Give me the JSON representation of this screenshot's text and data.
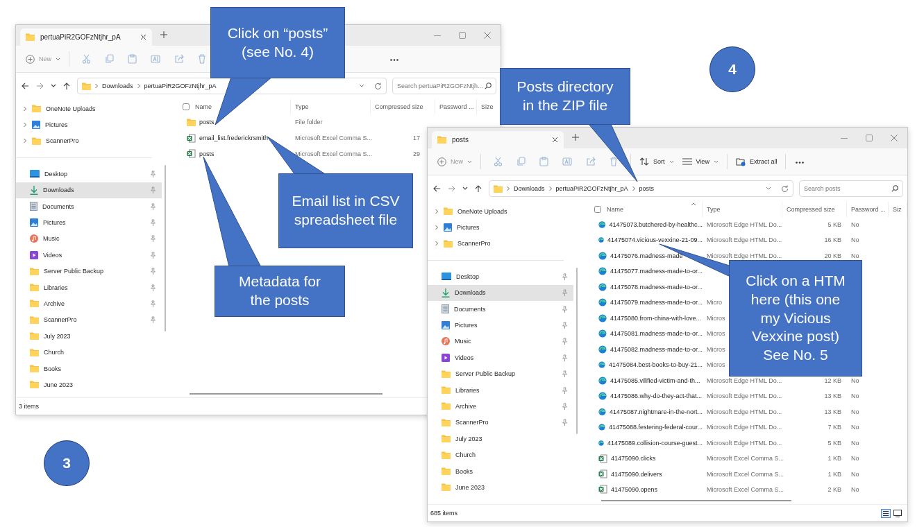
{
  "windows": [
    {
      "tab_title": "pertuaPiR2GOFzNtjhr_pA",
      "toolbar": [
        {
          "kind": "new",
          "label": "New"
        }
      ],
      "breadcrumb": [
        "Downloads",
        "pertuaPiR2GOFzNtjhr_pA"
      ],
      "search_placeholder": "Search pertuaPiR2GOFzNtjh...",
      "nav_tree": [
        {
          "label": "OneNote Uploads",
          "kind": "folder"
        },
        {
          "label": "Pictures",
          "kind": "pictures"
        },
        {
          "label": "ScannerPro",
          "kind": "folder"
        }
      ],
      "quick_access": [
        {
          "label": "Desktop",
          "kind": "desktop",
          "pinned": true,
          "selected": false
        },
        {
          "label": "Downloads",
          "kind": "downloads",
          "pinned": true,
          "selected": true
        },
        {
          "label": "Documents",
          "kind": "documents",
          "pinned": true,
          "selected": false
        },
        {
          "label": "Pictures",
          "kind": "pictures",
          "pinned": true,
          "selected": false
        },
        {
          "label": "Music",
          "kind": "music",
          "pinned": true,
          "selected": false
        },
        {
          "label": "Videos",
          "kind": "videos",
          "pinned": true,
          "selected": false
        },
        {
          "label": "Server Public Backup",
          "kind": "folder",
          "pinned": true,
          "selected": false
        },
        {
          "label": "Libraries",
          "kind": "folder",
          "pinned": true,
          "selected": false
        },
        {
          "label": "Archive",
          "kind": "folder",
          "pinned": true,
          "selected": false
        },
        {
          "label": "ScannerPro",
          "kind": "folder",
          "pinned": true,
          "selected": false
        },
        {
          "label": "July 2023",
          "kind": "folder",
          "pinned": false,
          "selected": false
        },
        {
          "label": "Church",
          "kind": "folder",
          "pinned": false,
          "selected": false
        },
        {
          "label": "Books",
          "kind": "folder",
          "pinned": false,
          "selected": false
        },
        {
          "label": "June 2023",
          "kind": "folder",
          "pinned": false,
          "selected": false
        }
      ],
      "columns": [
        {
          "label": "Name",
          "sorted": false
        },
        {
          "label": "Type",
          "sorted": false
        },
        {
          "label": "Compressed size",
          "sorted": false
        },
        {
          "label": "Password ...",
          "sorted": false
        },
        {
          "label": "Size",
          "sorted": false
        }
      ],
      "rows": [
        {
          "kind": "folder",
          "name": "posts",
          "type": "File folder"
        },
        {
          "kind": "csv",
          "name": "email_list.frederickrsmith",
          "type": "Microsoft Excel Comma S...",
          "compressed": "17"
        },
        {
          "kind": "csv",
          "name": "posts",
          "type": "Microsoft Excel Comma S...",
          "compressed": "29"
        }
      ],
      "header_checkbox": {
        "checked": false
      },
      "status": {
        "text": "3 items"
      }
    },
    {
      "tab_title": "posts",
      "toolbar": [
        {
          "kind": "new",
          "label": "New"
        },
        {
          "kind": "sort",
          "label": "Sort"
        },
        {
          "kind": "view",
          "label": "View"
        },
        {
          "kind": "extract",
          "label": "Extract all"
        }
      ],
      "breadcrumb": [
        "Downloads",
        "pertuaPiR2GOFzNtjhr_pA",
        "posts"
      ],
      "search_placeholder": "Search posts",
      "nav_tree": [
        {
          "label": "OneNote Uploads",
          "kind": "folder"
        },
        {
          "label": "Pictures",
          "kind": "pictures"
        },
        {
          "label": "ScannerPro",
          "kind": "folder"
        }
      ],
      "quick_access": [
        {
          "label": "Desktop",
          "kind": "desktop",
          "pinned": true,
          "selected": false
        },
        {
          "label": "Downloads",
          "kind": "downloads",
          "pinned": true,
          "selected": true
        },
        {
          "label": "Documents",
          "kind": "documents",
          "pinned": true,
          "selected": false
        },
        {
          "label": "Pictures",
          "kind": "pictures",
          "pinned": true,
          "selected": false
        },
        {
          "label": "Music",
          "kind": "music",
          "pinned": true,
          "selected": false
        },
        {
          "label": "Videos",
          "kind": "videos",
          "pinned": true,
          "selected": false
        },
        {
          "label": "Server Public Backup",
          "kind": "folder",
          "pinned": true,
          "selected": false
        },
        {
          "label": "Libraries",
          "kind": "folder",
          "pinned": true,
          "selected": false
        },
        {
          "label": "Archive",
          "kind": "folder",
          "pinned": true,
          "selected": false
        },
        {
          "label": "ScannerPro",
          "kind": "folder",
          "pinned": true,
          "selected": false
        },
        {
          "label": "July 2023",
          "kind": "folder",
          "pinned": false,
          "selected": false
        },
        {
          "label": "Church",
          "kind": "folder",
          "pinned": false,
          "selected": false
        },
        {
          "label": "Books",
          "kind": "folder",
          "pinned": false,
          "selected": false
        },
        {
          "label": "June 2023",
          "kind": "folder",
          "pinned": false,
          "selected": false
        }
      ],
      "columns": [
        {
          "label": "Name",
          "sorted": true
        },
        {
          "label": "Type",
          "sorted": false
        },
        {
          "label": "Compressed size",
          "sorted": false
        },
        {
          "label": "Password ...",
          "sorted": false
        },
        {
          "label": "Siz",
          "sorted": false
        }
      ],
      "rows": [
        {
          "kind": "edge",
          "name": "41475073.butchered-by-healthc...",
          "type": "Microsoft Edge HTML Do...",
          "compressed": "5 KB",
          "password": "No"
        },
        {
          "kind": "edge",
          "name": "41475074.vicious-vexxine-21-09...",
          "type": "Microsoft Edge HTML Do...",
          "compressed": "16 KB",
          "password": "No"
        },
        {
          "kind": "edge",
          "name": "41475076.madness-made",
          "type": "Microsoft Edge HTML Do...",
          "compressed": "20 KB",
          "password": "No"
        },
        {
          "kind": "edge",
          "name": "41475077.madness-made-to-or..."
        },
        {
          "kind": "edge",
          "name": "41475078.madness-made-to-or..."
        },
        {
          "kind": "edge",
          "name": "41475079.madness-made-to-or...",
          "type": "Micro"
        },
        {
          "kind": "edge",
          "name": "41475080.from-china-with-love...",
          "type": "Micros"
        },
        {
          "kind": "edge",
          "name": "41475081.madness-made-to-or...",
          "type": "Micros"
        },
        {
          "kind": "edge",
          "name": "41475082.madness-made-to-or...",
          "type": "Micros"
        },
        {
          "kind": "edge",
          "name": "41475084.best-books-to-buy-21...",
          "type": "Micros"
        },
        {
          "kind": "edge",
          "name": "41475085.vilified-victim-and-th...",
          "type": "Microsoft Edge HTML Do...",
          "compressed": "12 KB",
          "password": "No"
        },
        {
          "kind": "edge",
          "name": "41475086.why-do-they-act-that...",
          "type": "Microsoft Edge HTML Do...",
          "compressed": "13 KB",
          "password": "No"
        },
        {
          "kind": "edge",
          "name": "41475087.nightmare-in-the-nort...",
          "type": "Microsoft Edge HTML Do...",
          "compressed": "13 KB",
          "password": "No"
        },
        {
          "kind": "edge",
          "name": "41475088.festering-federal-cour...",
          "type": "Microsoft Edge HTML Do...",
          "compressed": "7 KB",
          "password": "No"
        },
        {
          "kind": "edge",
          "name": "41475089.collision-course-guest...",
          "type": "Microsoft Edge HTML Do...",
          "compressed": "5 KB",
          "password": "No"
        },
        {
          "kind": "csv",
          "name": "41475090.clicks",
          "type": "Microsoft Excel Comma S...",
          "compressed": "1 KB",
          "password": "No"
        },
        {
          "kind": "csv",
          "name": "41475090.delivers",
          "type": "Microsoft Excel Comma S...",
          "compressed": "1 KB",
          "password": "No"
        },
        {
          "kind": "csv",
          "name": "41475090.opens",
          "type": "Microsoft Excel Comma S...",
          "compressed": "2 KB",
          "password": "No"
        }
      ],
      "header_checkbox": {
        "checked": false
      },
      "status": {
        "text": "685 items",
        "view_toggles": true
      }
    }
  ],
  "callouts": [
    {
      "text": "Click on “posts” (see No. 4)"
    },
    {
      "text": "Email list in CSV spreadsheet file"
    },
    {
      "text": "Metadata for the posts"
    },
    {
      "text": "Posts directory in the ZIP file"
    },
    {
      "text": "Click on a HTM here (this one my Vicious Vexxine post) See No. 5"
    }
  ],
  "step_markers": [
    {
      "label": "4"
    },
    {
      "label": "3"
    }
  ]
}
